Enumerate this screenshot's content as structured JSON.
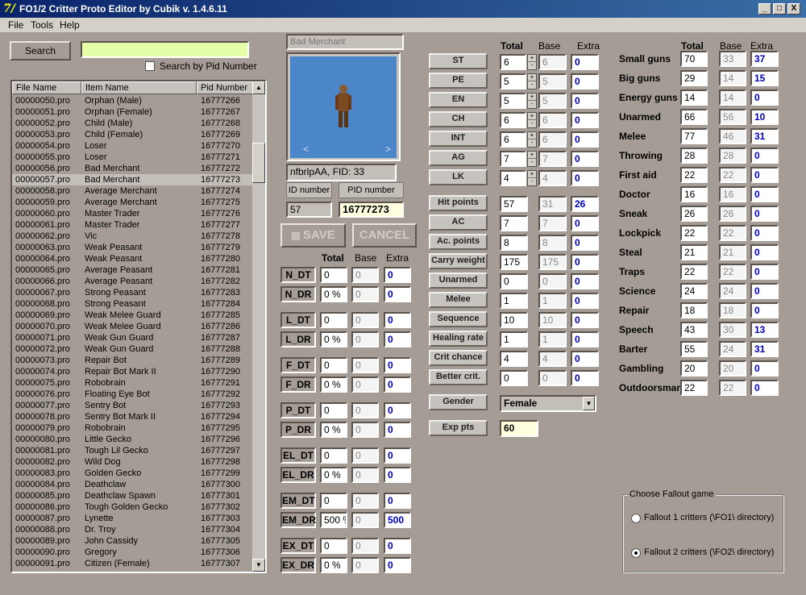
{
  "window": {
    "title": "FO1/2 Critter Proto Editor by Cubik   v. 1.4.6.11",
    "min": "_",
    "max": "□",
    "close": "X"
  },
  "menu": [
    "File",
    "Tools",
    "Help"
  ],
  "search": {
    "button": "Search",
    "value": "",
    "checkbox_label": "Search by Pid Number"
  },
  "list": {
    "headers": [
      "File Name",
      "Item Name",
      "Pid Number"
    ],
    "rows": [
      [
        "00000050.pro",
        "Orphan (Male)",
        "16777266"
      ],
      [
        "00000051.pro",
        "Orphan (Female)",
        "16777267"
      ],
      [
        "00000052.pro",
        "Child (Male)",
        "16777268"
      ],
      [
        "00000053.pro",
        "Child (Female)",
        "16777269"
      ],
      [
        "00000054.pro",
        "Loser",
        "16777270"
      ],
      [
        "00000055.pro",
        "Loser",
        "16777271"
      ],
      [
        "00000056.pro",
        "Bad Merchant",
        "16777272"
      ],
      [
        "00000057.pro",
        "Bad Merchant",
        "16777273"
      ],
      [
        "00000058.pro",
        "Average Merchant",
        "16777274"
      ],
      [
        "00000059.pro",
        "Average Merchant",
        "16777275"
      ],
      [
        "00000060.pro",
        "Master Trader",
        "16777276"
      ],
      [
        "00000061.pro",
        "Master Trader",
        "16777277"
      ],
      [
        "00000062.pro",
        "Vic",
        "16777278"
      ],
      [
        "00000063.pro",
        "Weak Peasant",
        "16777279"
      ],
      [
        "00000064.pro",
        "Weak Peasant",
        "16777280"
      ],
      [
        "00000065.pro",
        "Average Peasant",
        "16777281"
      ],
      [
        "00000066.pro",
        "Average Peasant",
        "16777282"
      ],
      [
        "00000067.pro",
        "Strong Peasant",
        "16777283"
      ],
      [
        "00000068.pro",
        "Strong Peasant",
        "16777284"
      ],
      [
        "00000069.pro",
        "Weak Melee Guard",
        "16777285"
      ],
      [
        "00000070.pro",
        "Weak Melee Guard",
        "16777286"
      ],
      [
        "00000071.pro",
        "Weak Gun Guard",
        "16777287"
      ],
      [
        "00000072.pro",
        "Weak Gun Guard",
        "16777288"
      ],
      [
        "00000073.pro",
        "Repair Bot",
        "16777289"
      ],
      [
        "00000074.pro",
        "Repair Bot Mark II",
        "16777290"
      ],
      [
        "00000075.pro",
        "Robobrain",
        "16777291"
      ],
      [
        "00000076.pro",
        "Floating Eye Bot",
        "16777292"
      ],
      [
        "00000077.pro",
        "Sentry Bot",
        "16777293"
      ],
      [
        "00000078.pro",
        "Sentry Bot Mark II",
        "16777294"
      ],
      [
        "00000079.pro",
        "Robobrain",
        "16777295"
      ],
      [
        "00000080.pro",
        "Little Gecko",
        "16777296"
      ],
      [
        "00000081.pro",
        "Tough Lil Gecko",
        "16777297"
      ],
      [
        "00000082.pro",
        "Wild Dog",
        "16777298"
      ],
      [
        "00000083.pro",
        "Golden Gecko",
        "16777299"
      ],
      [
        "00000084.pro",
        "Deathclaw",
        "16777300"
      ],
      [
        "00000085.pro",
        "Deathclaw Spawn",
        "16777301"
      ],
      [
        "00000086.pro",
        "Tough Golden Gecko",
        "16777302"
      ],
      [
        "00000087.pro",
        "Lynette",
        "16777303"
      ],
      [
        "00000088.pro",
        "Dr. Troy",
        "16777304"
      ],
      [
        "00000089.pro",
        "John Cassidy",
        "16777305"
      ],
      [
        "00000090.pro",
        "Gregory",
        "16777306"
      ],
      [
        "00000091.pro",
        "Citizen (Female)",
        "16777307"
      ]
    ],
    "selected_index": 7
  },
  "critter": {
    "name": "Bad Merchant",
    "preview_prev": "<",
    "preview_next": ">",
    "fid_text": "nfbrlpAA, FID: 33",
    "id_label": "ID number",
    "pid_label": "PID number",
    "id_value": "57",
    "pid_value": "16777273",
    "save": "SAVE",
    "cancel": "CANCEL"
  },
  "col_headers": {
    "total": "Total",
    "base": "Base",
    "extra": "Extra"
  },
  "damage": [
    {
      "label": "N_DT",
      "total": "0",
      "base": "0",
      "extra": "0"
    },
    {
      "label": "N_DR",
      "total": "0 %",
      "base": "0",
      "extra": "0"
    },
    {
      "label": "L_DT",
      "total": "0",
      "base": "0",
      "extra": "0"
    },
    {
      "label": "L_DR",
      "total": "0 %",
      "base": "0",
      "extra": "0"
    },
    {
      "label": "F_DT",
      "total": "0",
      "base": "0",
      "extra": "0"
    },
    {
      "label": "F_DR",
      "total": "0 %",
      "base": "0",
      "extra": "0"
    },
    {
      "label": "P_DT",
      "total": "0",
      "base": "0",
      "extra": "0"
    },
    {
      "label": "P_DR",
      "total": "0 %",
      "base": "0",
      "extra": "0"
    },
    {
      "label": "EL_DT",
      "total": "0",
      "base": "0",
      "extra": "0"
    },
    {
      "label": "EL_DR",
      "total": "0 %",
      "base": "0",
      "extra": "0"
    },
    {
      "label": "EM_DT",
      "total": "0",
      "base": "0",
      "extra": "0"
    },
    {
      "label": "EM_DR",
      "total": "500 %",
      "base": "0",
      "extra": "500"
    },
    {
      "label": "EX_DT",
      "total": "0",
      "base": "0",
      "extra": "0"
    },
    {
      "label": "EX_DR",
      "total": "0 %",
      "base": "0",
      "extra": "0"
    }
  ],
  "special": [
    {
      "label": "ST",
      "total": "6",
      "base": "6",
      "extra": "0"
    },
    {
      "label": "PE",
      "total": "5",
      "base": "5",
      "extra": "0"
    },
    {
      "label": "EN",
      "total": "5",
      "base": "5",
      "extra": "0"
    },
    {
      "label": "CH",
      "total": "6",
      "base": "6",
      "extra": "0"
    },
    {
      "label": "INT",
      "total": "6",
      "base": "6",
      "extra": "0"
    },
    {
      "label": "AG",
      "total": "7",
      "base": "7",
      "extra": "0"
    },
    {
      "label": "LK",
      "total": "4",
      "base": "4",
      "extra": "0"
    }
  ],
  "derived": [
    {
      "label": "Hit points",
      "total": "57",
      "base": "31",
      "extra": "26"
    },
    {
      "label": "AC",
      "total": "7",
      "base": "7",
      "extra": "0"
    },
    {
      "label": "Ac. points",
      "total": "8",
      "base": "8",
      "extra": "0"
    },
    {
      "label": "Carry weight",
      "total": "175",
      "base": "175",
      "extra": "0"
    },
    {
      "label": "Unarmed",
      "total": "0",
      "base": "0",
      "extra": "0"
    },
    {
      "label": "Melee",
      "total": "1",
      "base": "1",
      "extra": "0"
    },
    {
      "label": "Sequence",
      "total": "10",
      "base": "10",
      "extra": "0"
    },
    {
      "label": "Healing rate",
      "total": "1",
      "base": "1",
      "extra": "0"
    },
    {
      "label": "Crit chance",
      "total": "4",
      "base": "4",
      "extra": "0"
    },
    {
      "label": "Better crit.",
      "total": "0",
      "base": "0",
      "extra": "0"
    }
  ],
  "gender": {
    "label": "Gender",
    "value": "Female"
  },
  "exp": {
    "label": "Exp pts",
    "value": "60"
  },
  "skills": [
    {
      "label": "Small guns",
      "total": "70",
      "base": "33",
      "extra": "37"
    },
    {
      "label": "Big guns",
      "total": "29",
      "base": "14",
      "extra": "15"
    },
    {
      "label": "Energy guns",
      "total": "14",
      "base": "14",
      "extra": "0"
    },
    {
      "label": "Unarmed",
      "total": "66",
      "base": "56",
      "extra": "10"
    },
    {
      "label": "Melee",
      "total": "77",
      "base": "46",
      "extra": "31"
    },
    {
      "label": "Throwing",
      "total": "28",
      "base": "28",
      "extra": "0"
    },
    {
      "label": "First aid",
      "total": "22",
      "base": "22",
      "extra": "0"
    },
    {
      "label": "Doctor",
      "total": "16",
      "base": "16",
      "extra": "0"
    },
    {
      "label": "Sneak",
      "total": "26",
      "base": "26",
      "extra": "0"
    },
    {
      "label": "Lockpick",
      "total": "22",
      "base": "22",
      "extra": "0"
    },
    {
      "label": "Steal",
      "total": "21",
      "base": "21",
      "extra": "0"
    },
    {
      "label": "Traps",
      "total": "22",
      "base": "22",
      "extra": "0"
    },
    {
      "label": "Science",
      "total": "24",
      "base": "24",
      "extra": "0"
    },
    {
      "label": "Repair",
      "total": "18",
      "base": "18",
      "extra": "0"
    },
    {
      "label": "Speech",
      "total": "43",
      "base": "30",
      "extra": "13"
    },
    {
      "label": "Barter",
      "total": "55",
      "base": "24",
      "extra": "31"
    },
    {
      "label": "Gambling",
      "total": "20",
      "base": "20",
      "extra": "0"
    },
    {
      "label": "Outdoorsman",
      "total": "22",
      "base": "22",
      "extra": "0"
    }
  ],
  "game": {
    "title": "Choose Fallout game",
    "options": [
      "Fallout 1 critters (\\FO1\\ directory)",
      "Fallout 2 critters (\\FO2\\ directory)"
    ],
    "selected": 1
  }
}
